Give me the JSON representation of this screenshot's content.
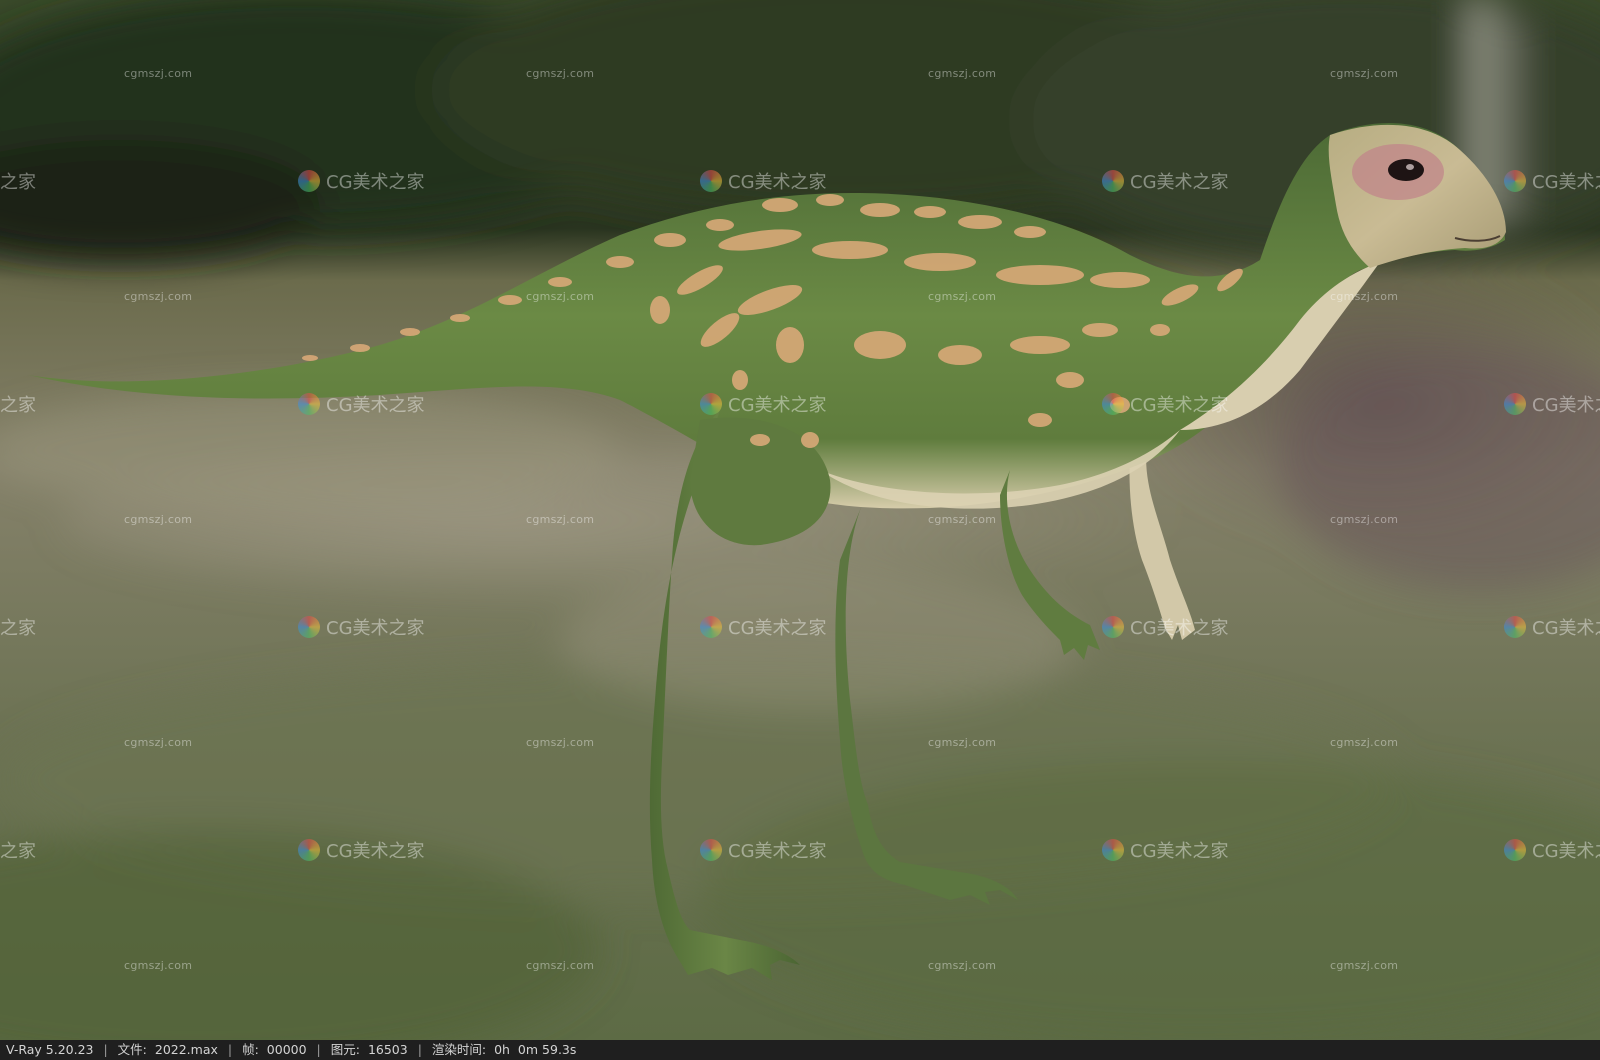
{
  "watermark": {
    "small_text": "cgmszj.com",
    "logo_text": "CG美术之家",
    "edge_text": "之家"
  },
  "statusbar": {
    "renderer": "V-Ray 5.20.23",
    "file_label": "文件:",
    "file_value": "2022.max",
    "frame_label": "帧:",
    "frame_value": "00000",
    "pixels_label": "图元:",
    "pixels_value": "16503",
    "time_label": "渲染时间:",
    "time_value": "0h  0m 59.3s",
    "separator": "|"
  },
  "colors": {
    "statusbar_bg": "#1f1f1f",
    "body_green": "#5e7a3c",
    "spot_tan": "#d2a774",
    "belly_cream": "#ddd2b4",
    "background_forest": "#2f3b22",
    "background_meadow": "#7d7a60"
  }
}
